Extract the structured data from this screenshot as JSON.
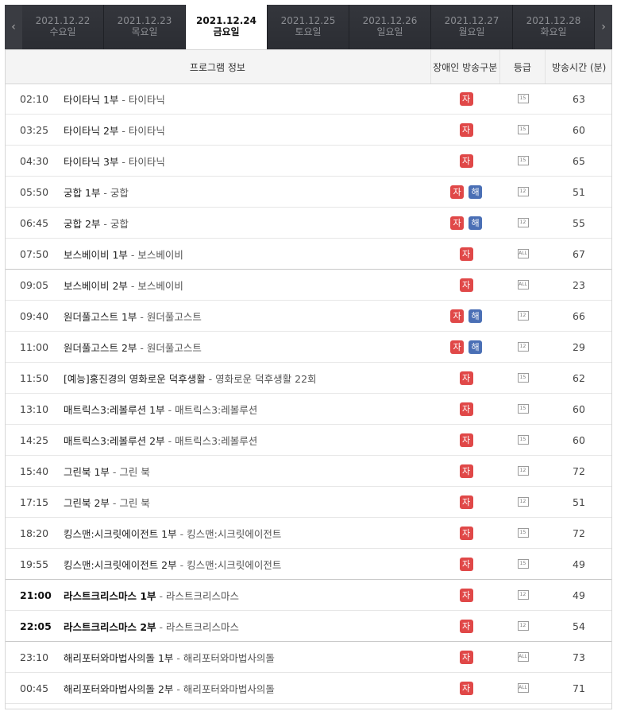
{
  "nav": {
    "prev_icon": "chevron-left-icon",
    "next_icon": "chevron-right-icon",
    "prev": "‹",
    "next": "›"
  },
  "days": [
    {
      "date": "2021.12.22",
      "weekday": "수요일",
      "active": false
    },
    {
      "date": "2021.12.23",
      "weekday": "목요일",
      "active": false
    },
    {
      "date": "2021.12.24",
      "weekday": "금요일",
      "active": true
    },
    {
      "date": "2021.12.25",
      "weekday": "토요일",
      "active": false
    },
    {
      "date": "2021.12.26",
      "weekday": "일요일",
      "active": false
    },
    {
      "date": "2021.12.27",
      "weekday": "월요일",
      "active": false
    },
    {
      "date": "2021.12.28",
      "weekday": "화요일",
      "active": false
    }
  ],
  "header": {
    "program": "프로그램 정보",
    "accessibility": "장애인 방송구분",
    "grade": "등급",
    "duration": "방송시간 (분)"
  },
  "badges": {
    "ja": "자",
    "hae": "해"
  },
  "rows": [
    {
      "time": "02:10",
      "title": "타이타닉 1부",
      "sub": "타이타닉",
      "ja": true,
      "hae": false,
      "grade": "15",
      "duration": "63",
      "bold": false,
      "sep": false
    },
    {
      "time": "03:25",
      "title": "타이타닉 2부",
      "sub": "타이타닉",
      "ja": true,
      "hae": false,
      "grade": "15",
      "duration": "60",
      "bold": false,
      "sep": false
    },
    {
      "time": "04:30",
      "title": "타이타닉 3부",
      "sub": "타이타닉",
      "ja": true,
      "hae": false,
      "grade": "15",
      "duration": "65",
      "bold": false,
      "sep": false
    },
    {
      "time": "05:50",
      "title": "궁합 1부",
      "sub": "궁합",
      "ja": true,
      "hae": true,
      "grade": "12",
      "duration": "51",
      "bold": false,
      "sep": false
    },
    {
      "time": "06:45",
      "title": "궁합 2부",
      "sub": "궁합",
      "ja": true,
      "hae": true,
      "grade": "12",
      "duration": "55",
      "bold": false,
      "sep": false
    },
    {
      "time": "07:50",
      "title": "보스베이비 1부",
      "sub": "보스베이비",
      "ja": true,
      "hae": false,
      "grade": "all",
      "duration": "67",
      "bold": false,
      "sep": true
    },
    {
      "time": "09:05",
      "title": "보스베이비 2부",
      "sub": "보스베이비",
      "ja": true,
      "hae": false,
      "grade": "all",
      "duration": "23",
      "bold": false,
      "sep": false
    },
    {
      "time": "09:40",
      "title": "원더풀고스트 1부",
      "sub": "원더풀고스트",
      "ja": true,
      "hae": true,
      "grade": "12",
      "duration": "66",
      "bold": false,
      "sep": false
    },
    {
      "time": "11:00",
      "title": "원더풀고스트 2부",
      "sub": "원더풀고스트",
      "ja": true,
      "hae": true,
      "grade": "12",
      "duration": "29",
      "bold": false,
      "sep": false
    },
    {
      "time": "11:50",
      "title": "[예능]홍진경의 영화로운 덕후생활",
      "sub": "영화로운 덕후생활 22회",
      "ja": true,
      "hae": false,
      "grade": "15",
      "duration": "62",
      "bold": false,
      "sep": false
    },
    {
      "time": "13:10",
      "title": "매트릭스3:레볼루션 1부",
      "sub": "매트릭스3:레볼루션",
      "ja": true,
      "hae": false,
      "grade": "15",
      "duration": "60",
      "bold": false,
      "sep": false
    },
    {
      "time": "14:25",
      "title": "매트릭스3:레볼루션 2부",
      "sub": "매트릭스3:레볼루션",
      "ja": true,
      "hae": false,
      "grade": "15",
      "duration": "60",
      "bold": false,
      "sep": false
    },
    {
      "time": "15:40",
      "title": "그린북 1부",
      "sub": "그린 북",
      "ja": true,
      "hae": false,
      "grade": "12",
      "duration": "72",
      "bold": false,
      "sep": false
    },
    {
      "time": "17:15",
      "title": "그린북 2부",
      "sub": "그린 북",
      "ja": true,
      "hae": false,
      "grade": "12",
      "duration": "51",
      "bold": false,
      "sep": false
    },
    {
      "time": "18:20",
      "title": "킹스맨:시크릿에이전트 1부",
      "sub": "킹스맨:시크릿에이전트",
      "ja": true,
      "hae": false,
      "grade": "15",
      "duration": "72",
      "bold": false,
      "sep": false
    },
    {
      "time": "19:55",
      "title": "킹스맨:시크릿에이전트 2부",
      "sub": "킹스맨:시크릿에이전트",
      "ja": true,
      "hae": false,
      "grade": "15",
      "duration": "49",
      "bold": false,
      "sep": true
    },
    {
      "time": "21:00",
      "title": "라스트크리스마스 1부",
      "sub": "라스트크리스마스",
      "ja": true,
      "hae": false,
      "grade": "12",
      "duration": "49",
      "bold": true,
      "sep": false
    },
    {
      "time": "22:05",
      "title": "라스트크리스마스 2부",
      "sub": "라스트크리스마스",
      "ja": true,
      "hae": false,
      "grade": "12",
      "duration": "54",
      "bold": true,
      "sep": true
    },
    {
      "time": "23:10",
      "title": "해리포터와마법사의돌 1부",
      "sub": "해리포터와마법사의돌",
      "ja": true,
      "hae": false,
      "grade": "all",
      "duration": "73",
      "bold": false,
      "sep": false
    },
    {
      "time": "00:45",
      "title": "해리포터와마법사의돌 2부",
      "sub": "해리포터와마법사의돌",
      "ja": true,
      "hae": false,
      "grade": "all",
      "duration": "71",
      "bold": false,
      "sep": false
    }
  ]
}
